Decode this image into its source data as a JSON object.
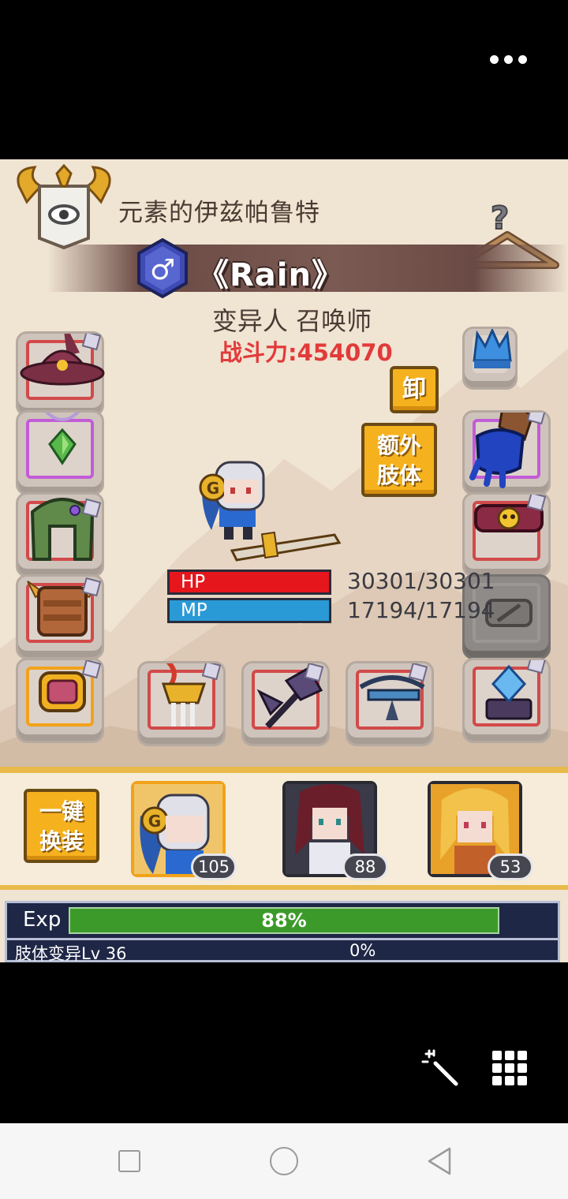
{
  "header": {
    "class_title": "元素的伊兹帕鲁特",
    "player_name": "《Rain》",
    "gender_symbol": "♂",
    "subclass": "变异人 召唤师",
    "combat_power": "战斗力:454070"
  },
  "buttons": {
    "unequip_label": "卸",
    "extra_limb_line1": "额外",
    "extra_limb_line2": "肢体",
    "one_click_line1": "一键",
    "one_click_line2": "换装"
  },
  "stats": {
    "hp_label": "HP",
    "mp_label": "MP",
    "hp_value": "30301/30301",
    "mp_value": "17194/17194",
    "hp_fraction": 1.0,
    "mp_fraction": 1.0
  },
  "party": [
    {
      "level": "105",
      "selected": true
    },
    {
      "level": "88",
      "selected": false
    },
    {
      "level": "53",
      "selected": false
    }
  ],
  "experience": {
    "label": "Exp",
    "percent": "88%",
    "fraction": 0.88,
    "limb_label": "肢体变异Lv 36",
    "limb_percent": "0%"
  },
  "colors": {
    "hp_bar": "#e5161c",
    "mp_bar": "#2a9ad6",
    "exp_bar": "#3c9a2a",
    "power_text": "#e23a3a",
    "gold_button": "#f5b21e"
  },
  "icons": {
    "menu": "more-dots-icon",
    "wand": "magic-wand-icon",
    "grid": "app-grid-icon",
    "nav_recent": "square-icon",
    "nav_home": "circle-icon",
    "nav_back": "back-triangle-icon"
  }
}
